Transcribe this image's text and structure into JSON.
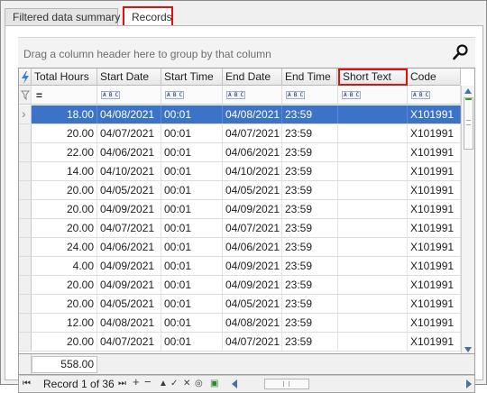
{
  "tabs": [
    {
      "label": "Filtered data summary"
    },
    {
      "label": "Records"
    }
  ],
  "group_panel": {
    "text": "Drag a column header here to group by that column"
  },
  "columns": [
    "Total Hours",
    "Start Date",
    "Start Time",
    "End Date",
    "End Time",
    "Short Text",
    "Code"
  ],
  "filter_row": {
    "total_hours_op": "=",
    "text_op_icon": "A B C"
  },
  "rows": [
    [
      "18.00",
      "04/08/2021",
      "00:01",
      "04/08/2021",
      "23:59",
      "",
      "X101991"
    ],
    [
      "20.00",
      "04/07/2021",
      "00:01",
      "04/07/2021",
      "23:59",
      "",
      "X101991"
    ],
    [
      "22.00",
      "04/06/2021",
      "00:01",
      "04/06/2021",
      "23:59",
      "",
      "X101991"
    ],
    [
      "14.00",
      "04/10/2021",
      "00:01",
      "04/10/2021",
      "23:59",
      "",
      "X101991"
    ],
    [
      "20.00",
      "04/05/2021",
      "00:01",
      "04/05/2021",
      "23:59",
      "",
      "X101991"
    ],
    [
      "20.00",
      "04/09/2021",
      "00:01",
      "04/09/2021",
      "23:59",
      "",
      "X101991"
    ],
    [
      "20.00",
      "04/07/2021",
      "00:01",
      "04/07/2021",
      "23:59",
      "",
      "X101991"
    ],
    [
      "24.00",
      "04/06/2021",
      "00:01",
      "04/06/2021",
      "23:59",
      "",
      "X101991"
    ],
    [
      "4.00",
      "04/09/2021",
      "00:01",
      "04/09/2021",
      "23:59",
      "",
      "X101991"
    ],
    [
      "20.00",
      "04/09/2021",
      "00:01",
      "04/09/2021",
      "23:59",
      "",
      "X101991"
    ],
    [
      "20.00",
      "04/05/2021",
      "00:01",
      "04/05/2021",
      "23:59",
      "",
      "X101991"
    ],
    [
      "12.00",
      "04/08/2021",
      "00:01",
      "04/08/2021",
      "23:59",
      "",
      "X101991"
    ],
    [
      "20.00",
      "04/07/2021",
      "00:01",
      "04/07/2021",
      "23:59",
      "",
      "X101991"
    ]
  ],
  "summary": {
    "total": "558.00"
  },
  "navigator": {
    "record_text": "Record 1 of 36"
  },
  "colors": {
    "selection": "#3b73c9",
    "highlight_border": "#e01010",
    "scroll_arrow": "#4a6ea9"
  }
}
